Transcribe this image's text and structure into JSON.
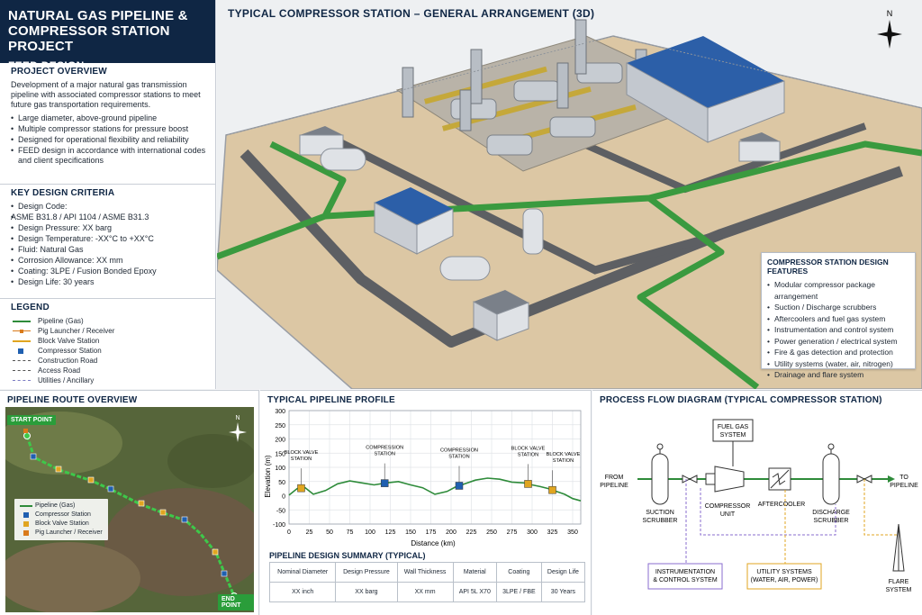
{
  "project": {
    "title_line1": "NATURAL GAS PIPELINE &",
    "title_line2": "COMPRESSOR STATION PROJECT",
    "subtitle": "FEED DESIGN"
  },
  "overview": {
    "heading": "PROJECT OVERVIEW",
    "description": "Development of a major natural gas transmission pipeline with associated compressor stations to meet future gas transportation requirements.",
    "bullets": [
      "Large diameter, above-ground pipeline",
      "Multiple compressor stations for pressure boost",
      "Designed for operational flexibility and reliability",
      "FEED design in accordance with international codes and client specifications"
    ]
  },
  "criteria": {
    "heading": "KEY DESIGN CRITERIA",
    "items": [
      "Design Code:",
      "ASME B31.8 / API 1104 / ASME B31.3",
      "Design Pressure: XX barg",
      "Design Temperature: -XX°C to +XX°C",
      "Fluid: Natural Gas",
      "Corrosion Allowance: XX mm",
      "Coating: 3LPE / Fusion Bonded Epoxy",
      "Design Life: 30 years"
    ]
  },
  "legend": {
    "heading": "LEGEND",
    "items": [
      {
        "label": "Pipeline (Gas)",
        "color": "#2e8b3a"
      },
      {
        "label": "Pig Launcher / Receiver",
        "color": "#d97a1a"
      },
      {
        "label": "Block Valve Station",
        "color": "#e0a520"
      },
      {
        "label": "Compressor Station",
        "color": "#1f5fb0"
      },
      {
        "label": "Construction Road",
        "color": "#555555"
      },
      {
        "label": "Access Road",
        "color": "#555555"
      },
      {
        "label": "Utilities / Ancillary",
        "color": "#7c7cc4"
      }
    ]
  },
  "scene": {
    "title": "TYPICAL COMPRESSOR STATION – GENERAL ARRANGEMENT (3D)",
    "north": "N"
  },
  "features": {
    "heading": "COMPRESSOR STATION DESIGN FEATURES",
    "items": [
      "Modular compressor package arrangement",
      "Suction / Discharge scrubbers",
      "Aftercoolers and fuel gas system",
      "Instrumentation and control system",
      "Power generation / electrical system",
      "Fire & gas detection and protection",
      "Utility systems (water, air, nitrogen)",
      "Drainage and flare system"
    ]
  },
  "route": {
    "heading": "PIPELINE ROUTE OVERVIEW",
    "start": "START POINT",
    "end": "END POINT",
    "north": "N",
    "legend": [
      "Pipeline (Gas)",
      "Compressor Station",
      "Block Valve Station",
      "Pig Launcher / Receiver"
    ]
  },
  "profile": {
    "heading": "TYPICAL PIPELINE PROFILE",
    "markers": [
      {
        "label": "BLOCK VALVE STATION",
        "x": 15,
        "type": "valve"
      },
      {
        "label": "COMPRESSION STATION",
        "x": 118,
        "type": "comp"
      },
      {
        "label": "COMPRESSION STATION",
        "x": 210,
        "type": "comp"
      },
      {
        "label": "BLOCK VALVE STATION",
        "x": 295,
        "type": "valve"
      },
      {
        "label": "BLOCK VALVE STATION",
        "x": 325,
        "type": "valve"
      }
    ]
  },
  "chart_data": {
    "type": "line",
    "xlabel": "Distance (km)",
    "ylabel": "Elevation (m)",
    "xlim": [
      0,
      360
    ],
    "ylim": [
      -100,
      300
    ],
    "xticks": [
      0,
      25,
      50,
      75,
      100,
      125,
      150,
      175,
      200,
      225,
      250,
      275,
      300,
      325,
      350
    ],
    "yticks": [
      -100,
      -50,
      0,
      50,
      100,
      150,
      200,
      250,
      300
    ],
    "x": [
      0,
      10,
      20,
      30,
      45,
      60,
      75,
      90,
      105,
      120,
      135,
      150,
      165,
      180,
      195,
      205,
      215,
      230,
      245,
      260,
      275,
      290,
      300,
      310,
      320,
      330,
      340,
      350,
      360
    ],
    "y": [
      2,
      25,
      28,
      5,
      18,
      42,
      52,
      45,
      38,
      45,
      50,
      38,
      28,
      5,
      15,
      30,
      40,
      55,
      62,
      58,
      48,
      45,
      38,
      32,
      25,
      15,
      5,
      -10,
      -18
    ],
    "grid": true
  },
  "summary": {
    "heading": "PIPELINE DESIGN SUMMARY (TYPICAL)",
    "headers": [
      "Nominal Diameter",
      "Design Pressure",
      "Wall Thickness",
      "Material",
      "Coating",
      "Design Life"
    ],
    "values": [
      "XX inch",
      "XX barg",
      "XX mm",
      "API 5L X70",
      "3LPE / FBE",
      "30 Years"
    ]
  },
  "pfd": {
    "heading": "PROCESS FLOW DIAGRAM (TYPICAL COMPRESSOR STATION)",
    "from": [
      "FROM",
      "PIPELINE"
    ],
    "to": [
      "TO",
      "PIPELINE"
    ],
    "fuel": [
      "FUEL GAS",
      "SYSTEM"
    ],
    "suction": [
      "SUCTION",
      "SCRUBBER"
    ],
    "compressor": [
      "COMPRESSOR",
      "UNIT"
    ],
    "aftercooler": "AFTERCOOLER",
    "discharge": [
      "DISCHARGE",
      "SCRUBBER"
    ],
    "ics": [
      "INSTRUMENTATION",
      "& CONTROL SYSTEM"
    ],
    "utility": [
      "UTILITY SYSTEMS",
      "(WATER, AIR, POWER)"
    ],
    "flare": [
      "FLARE",
      "SYSTEM"
    ]
  }
}
